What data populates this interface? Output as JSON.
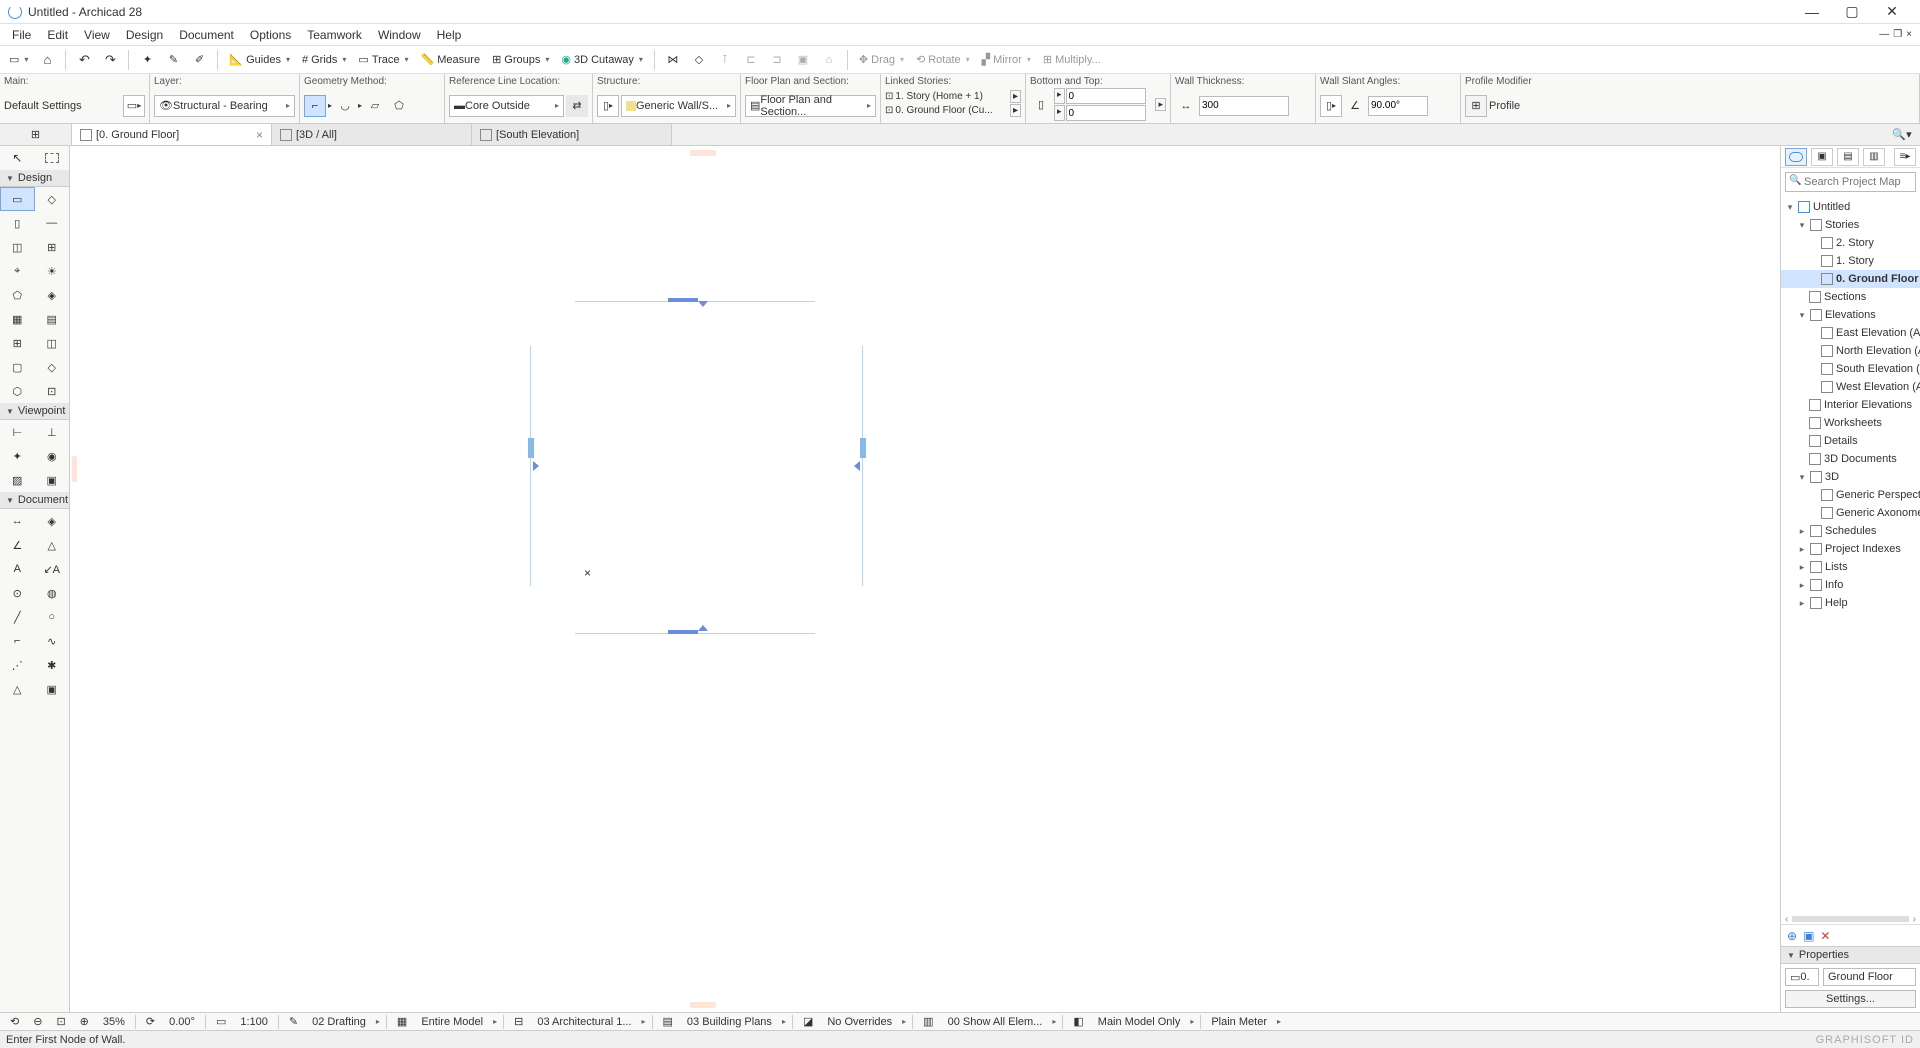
{
  "window": {
    "title": "Untitled - Archicad 28"
  },
  "menu": [
    "File",
    "Edit",
    "View",
    "Design",
    "Document",
    "Options",
    "Teamwork",
    "Window",
    "Help"
  ],
  "toolbar1": {
    "guides": "Guides",
    "grids": "Grids",
    "trace": "Trace",
    "measure": "Measure",
    "groups": "Groups",
    "cutaway": "3D Cutaway",
    "drag": "Drag",
    "rotate": "Rotate",
    "mirror": "Mirror",
    "multiply": "Multiply..."
  },
  "infobox": {
    "main": {
      "label": "Main:",
      "value": "Default Settings"
    },
    "layer": {
      "label": "Layer:",
      "value": "Structural - Bearing"
    },
    "geometry": {
      "label": "Geometry Method:"
    },
    "refline": {
      "label": "Reference Line Location:",
      "value": "Core Outside"
    },
    "structure": {
      "label": "Structure:",
      "value": "Generic Wall/S..."
    },
    "floorplan": {
      "label": "Floor Plan and Section:",
      "value": "Floor Plan and Section..."
    },
    "linked": {
      "label": "Linked Stories:",
      "story1": "1. Story (Home + 1)",
      "story0": "0. Ground Floor (Cu..."
    },
    "bottomtop": {
      "label": "Bottom and Top:",
      "val1": "0",
      "val2": "0"
    },
    "thickness": {
      "label": "Wall Thickness:",
      "value": "300"
    },
    "slant": {
      "label": "Wall Slant Angles:",
      "value": "90.00°"
    },
    "profile": {
      "label": "Profile Modifier",
      "value": "Profile"
    }
  },
  "tabs": [
    {
      "label": "[0. Ground Floor]",
      "active": true
    },
    {
      "label": "[3D / All]",
      "active": false
    },
    {
      "label": "[South Elevation]",
      "active": false
    }
  ],
  "toolbox": {
    "design": "Design",
    "viewpoint": "Viewpoint",
    "document": "Document"
  },
  "navigator": {
    "search_placeholder": "Search Project Map",
    "root": "Untitled",
    "stories": {
      "label": "Stories",
      "items": [
        "2. Story",
        "1. Story",
        "0. Ground Floor"
      ]
    },
    "sections": "Sections",
    "elevations": {
      "label": "Elevations",
      "items": [
        "East Elevation (Auto-re",
        "North Elevation (Auto-",
        "South Elevation (Auto-",
        "West Elevation (Auto-r"
      ]
    },
    "interior": "Interior Elevations",
    "worksheets": "Worksheets",
    "details": "Details",
    "docs3d": "3D Documents",
    "threeD": {
      "label": "3D",
      "items": [
        "Generic Perspective",
        "Generic Axonometry"
      ]
    },
    "schedules": "Schedules",
    "indexes": "Project Indexes",
    "lists": "Lists",
    "info": "Info",
    "help": "Help",
    "selected": "0. Ground Floor"
  },
  "properties": {
    "header": "Properties",
    "story_short": "0.",
    "story_name": "Ground Floor",
    "settings": "Settings..."
  },
  "statusbar": {
    "zoom": "35%",
    "angle": "0.00°",
    "scale": "1:100",
    "penset": "02 Drafting",
    "model": "Entire Model",
    "viewset": "03 Architectural 1...",
    "layout": "03 Building Plans",
    "overrides": "No Overrides",
    "filter": "00 Show All Elem...",
    "mvo": "Main Model Only",
    "units": "Plain Meter"
  },
  "bottom": {
    "hint": "Enter First Node of Wall.",
    "brand": "GRAPHISOFT ID"
  }
}
